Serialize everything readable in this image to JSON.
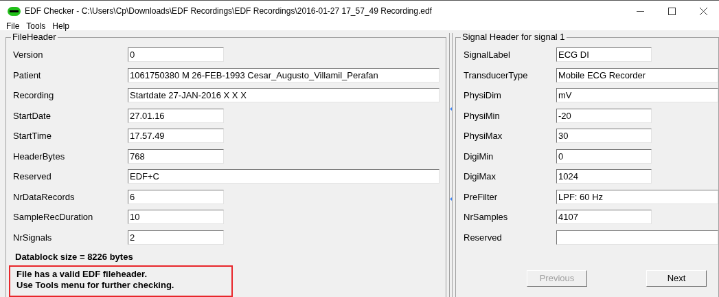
{
  "window": {
    "title": "EDF Checker - C:\\Users\\Cp\\Downloads\\EDF Recordings\\EDF Recordings\\2016-01-27 17_57_49 Recording.edf"
  },
  "menu": [
    "File",
    "Tools",
    "Help"
  ],
  "file_header": {
    "title": "FileHeader",
    "fields": [
      {
        "label": "Version",
        "value": "0",
        "kind": "short"
      },
      {
        "label": "Patient",
        "value": "1061750380 M 26-FEB-1993 Cesar_Augusto_Villamil_Perafan",
        "kind": "long"
      },
      {
        "label": "Recording",
        "value": "Startdate 27-JAN-2016 X X X",
        "kind": "long"
      },
      {
        "label": "StartDate",
        "value": "27.01.16",
        "kind": "short"
      },
      {
        "label": "StartTime",
        "value": "17.57.49",
        "kind": "short"
      },
      {
        "label": "HeaderBytes",
        "value": "768",
        "kind": "short"
      },
      {
        "label": "Reserved",
        "value": "EDF+C",
        "kind": "long"
      },
      {
        "label": "NrDataRecords",
        "value": "6",
        "kind": "short"
      },
      {
        "label": "SampleRecDuration",
        "value": "10",
        "kind": "short"
      },
      {
        "label": "NrSignals",
        "value": "2",
        "kind": "short"
      }
    ],
    "datablock": "Datablock size = 8226 bytes",
    "messages": [
      "File has a valid EDF fileheader.",
      "Use Tools menu for further checking."
    ]
  },
  "signal_header": {
    "title": "Signal Header for signal 1",
    "fields": [
      {
        "label": "SignalLabel",
        "value": "ECG DI",
        "kind": "short"
      },
      {
        "label": "TransducerType",
        "value": "Mobile ECG Recorder",
        "kind": "long"
      },
      {
        "label": "PhysiDim",
        "value": "mV",
        "kind": "long"
      },
      {
        "label": "PhysiMin",
        "value": "-20",
        "kind": "short"
      },
      {
        "label": "PhysiMax",
        "value": "30",
        "kind": "short"
      },
      {
        "label": "DigiMin",
        "value": "0",
        "kind": "short"
      },
      {
        "label": "DigiMax",
        "value": "1024",
        "kind": "short"
      },
      {
        "label": "PreFilter",
        "value": "LPF: 60 Hz",
        "kind": "long"
      },
      {
        "label": "NrSamples",
        "value": "4107",
        "kind": "short"
      },
      {
        "label": "Reserved",
        "kind": "long"
      }
    ],
    "buttons": [
      {
        "label": "Previous",
        "disabled": true
      },
      {
        "label": "Next",
        "disabled": false
      }
    ]
  }
}
